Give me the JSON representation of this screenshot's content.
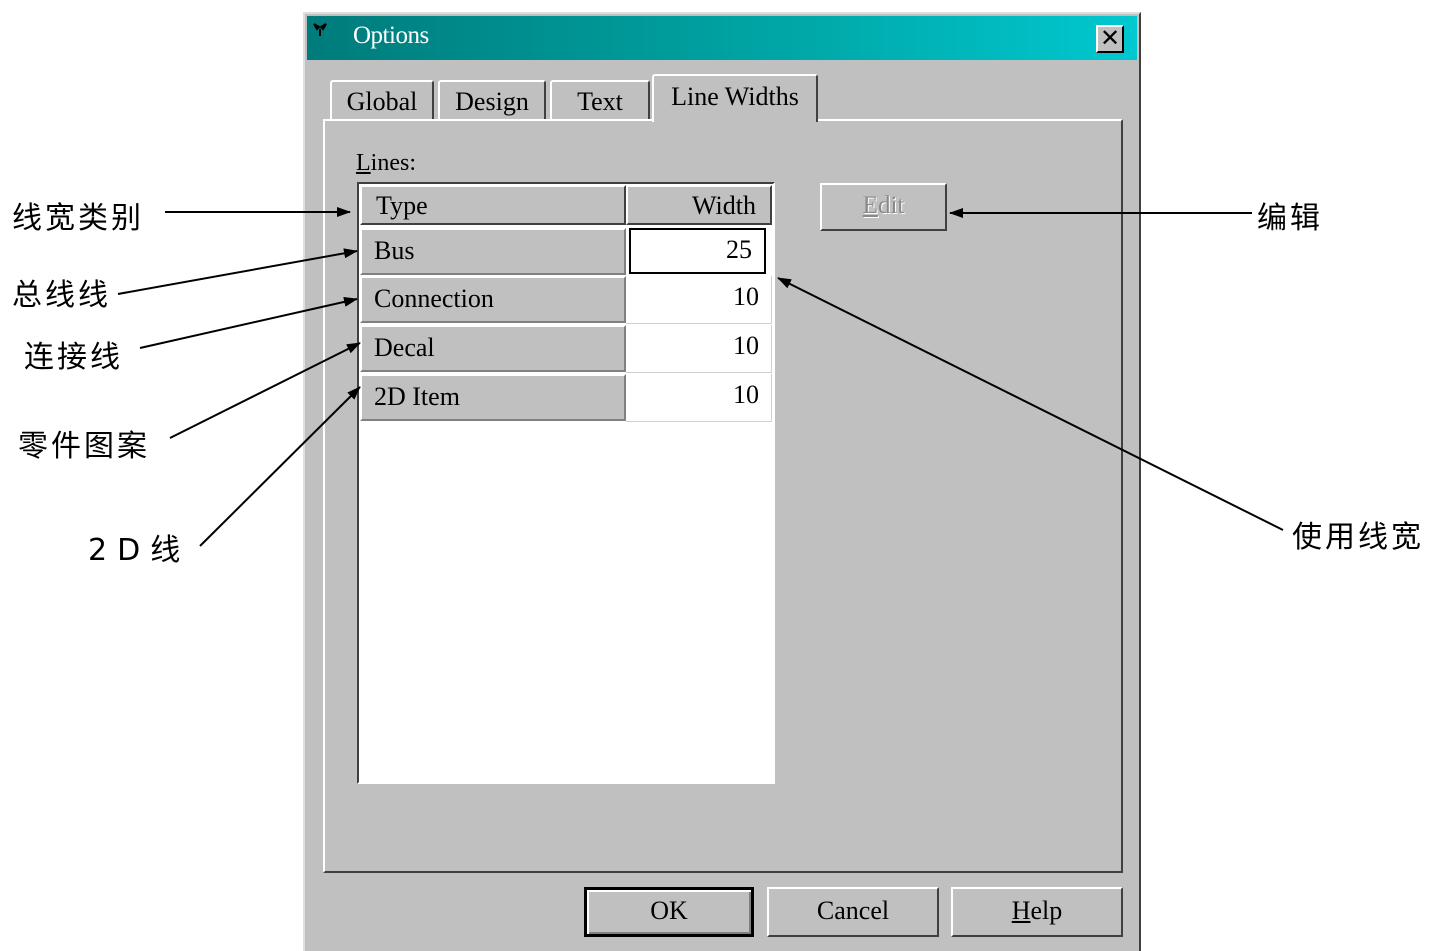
{
  "window": {
    "title": "Options",
    "close_label": "✕"
  },
  "tabs": [
    {
      "label": "Global",
      "active": false
    },
    {
      "label": "Design",
      "active": false
    },
    {
      "label": "Text",
      "active": false
    },
    {
      "label": "Line Widths",
      "active": true
    }
  ],
  "lines": {
    "label_accel": "L",
    "label_rest": "ines:",
    "columns": {
      "type": "Type",
      "width": "Width"
    },
    "rows": [
      {
        "type": "Bus",
        "width": "25"
      },
      {
        "type": "Connection",
        "width": "10"
      },
      {
        "type": "Decal",
        "width": "10"
      },
      {
        "type": "2D Item",
        "width": "10"
      }
    ]
  },
  "edit_button": {
    "accel": "E",
    "rest": "dit"
  },
  "buttons": {
    "ok": "OK",
    "cancel": "Cancel",
    "help_accel": "H",
    "help_rest": "elp"
  },
  "annotations": {
    "line_width_type": "线宽类别",
    "bus_line": "总线线",
    "connection_line": "连接线",
    "part_pattern": "零件图案",
    "line_2d_prefix": "2D",
    "line_2d_suffix": "线",
    "edit": "编辑",
    "used_width": "使用线宽"
  },
  "colors": {
    "title_start": "#007b7b",
    "title_end": "#00c8d0",
    "face": "#c0c0c0"
  }
}
